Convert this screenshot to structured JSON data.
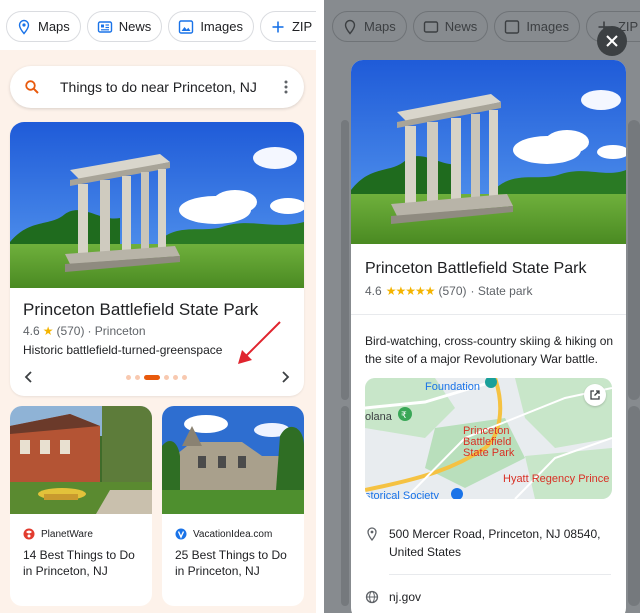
{
  "chips": [
    {
      "label": "Maps",
      "icon": "map-pin-icon"
    },
    {
      "label": "News",
      "icon": "news-icon"
    },
    {
      "label": "Images",
      "icon": "image-icon"
    },
    {
      "label": "ZIP Code",
      "icon": "plus-icon"
    }
  ],
  "search": {
    "query": "Things to do near Princeton, NJ"
  },
  "main_card": {
    "title": "Princeton Battlefield State Park",
    "rating": "4.6",
    "reviews": "(570)",
    "location": "· Princeton",
    "description": "Historic battlefield-turned-greenspace",
    "carousel_total": 6,
    "carousel_active": 3
  },
  "articles": [
    {
      "source": "PlanetWare",
      "title": "14 Best Things to Do in Princeton, NJ"
    },
    {
      "source": "VacationIdea.com",
      "title": "25 Best Things to Do in Princeton, NJ"
    }
  ],
  "detail": {
    "title": "Princeton Battlefield State Park",
    "rating": "4.6",
    "stars": "★★★★★",
    "reviews": "(570)",
    "category": "· State park",
    "description": "Bird-watching, cross-country skiing & hiking on the site of a major Revolutionary War battle.",
    "map": {
      "label_foundation": "Foundation",
      "label_polana": "olana",
      "label_park_1": "Princeton",
      "label_park_2": "Battlefield",
      "label_park_3": "State Park",
      "label_hyatt": "Hyatt Regency Prince",
      "label_society": "storical Society"
    },
    "address_1": "500 Mercer Road, Princeton, NJ 08540,",
    "address_2": "United States",
    "website": "nj.gov"
  },
  "colors": {
    "accent": "#e8590c",
    "star": "#f4b400",
    "arrow": "#e0242e",
    "overlay": "#878b8f"
  }
}
